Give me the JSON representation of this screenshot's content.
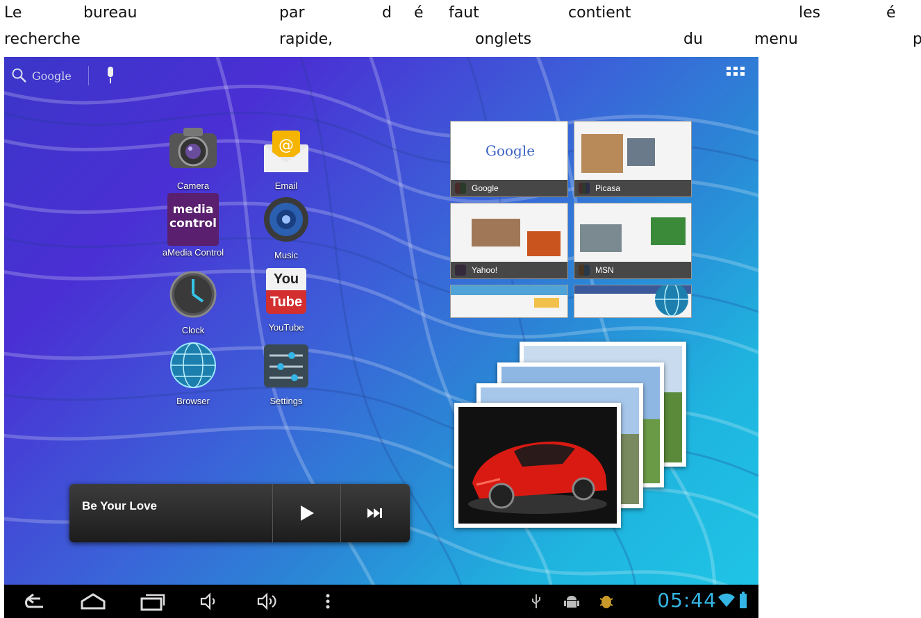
{
  "caption": {
    "line1": [
      "Le",
      "bureau",
      "par",
      "d",
      "é",
      "faut",
      "contient",
      "les",
      "é"
    ],
    "line2": [
      "recherche",
      "rapide,",
      "onglets",
      "du",
      "menu",
      "p"
    ]
  },
  "search": {
    "label": "Google"
  },
  "shortcuts": [
    {
      "label": "Camera"
    },
    {
      "label": "Email"
    },
    {
      "label": "aMedia Control",
      "icon_text_1": "media",
      "icon_text_2": "control"
    },
    {
      "label": "Music"
    },
    {
      "label": "Clock"
    },
    {
      "label": "YouTube",
      "icon_text_1": "You",
      "icon_text_2": "Tube"
    },
    {
      "label": "Browser"
    },
    {
      "label": "Settings"
    }
  ],
  "bookmarks": [
    {
      "label": "Google",
      "logo": "Google"
    },
    {
      "label": "Picasa"
    },
    {
      "label": "Yahoo!"
    },
    {
      "label": "MSN"
    },
    {
      "label": ""
    },
    {
      "label": ""
    }
  ],
  "music": {
    "song": "Be Your Love"
  },
  "status": {
    "time": "05:44"
  },
  "colors": {
    "clock": "#35b5e5",
    "accent": "#33b5e5"
  }
}
